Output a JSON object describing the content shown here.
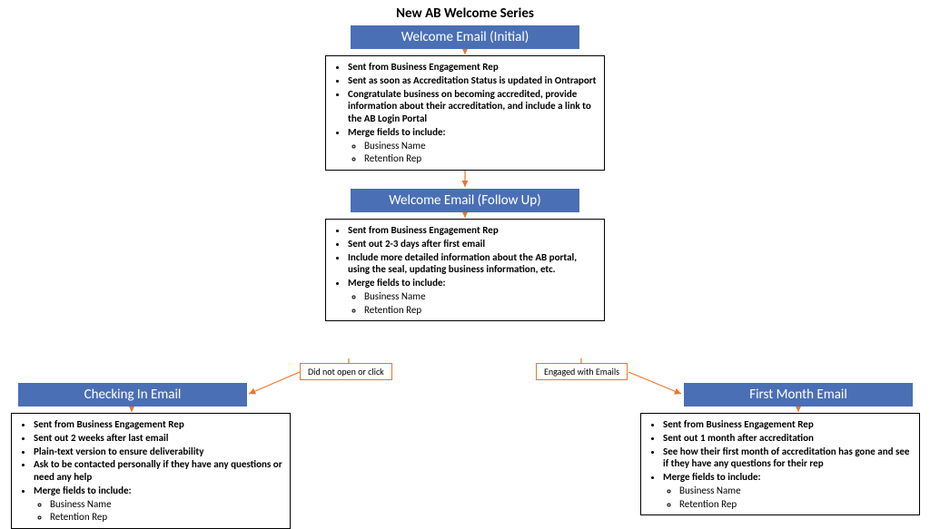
{
  "title": "New AB Welcome Series",
  "nodes": {
    "initial": {
      "header": "Welcome Email (Initial)",
      "b1": "Sent from Business Engagement Rep",
      "b2": "Sent as soon as Accreditation Status is updated in Ontraport",
      "b3": "Congratulate business on becoming accredited, provide information about their accreditation, and include a link to the AB Login Portal",
      "b4": "Merge fields to include:",
      "m1": "Business Name",
      "m2": "Retention Rep"
    },
    "followup": {
      "header": "Welcome Email (Follow Up)",
      "b1": "Sent from Business Engagement Rep",
      "b2": "Sent out 2-3 days after first email",
      "b3": "Include more detailed information about the AB portal, using the seal, updating business information, etc.",
      "b4": "Merge fields to include:",
      "m1": "Business Name",
      "m2": "Retention Rep"
    },
    "checkin": {
      "header": "Checking In Email",
      "b1": "Sent from Business Engagement Rep",
      "b2": "Sent out 2 weeks after last email",
      "b3": "Plain-text version to ensure deliverability",
      "b4": "Ask to be contacted personally if they have any questions or need any help",
      "b5": "Merge fields to include:",
      "m1": "Business Name",
      "m2": "Retention Rep"
    },
    "firstmonth": {
      "header": "First Month Email",
      "b1": "Sent from Business Engagement Rep",
      "b2": "Sent out 1 month after accreditation",
      "b3": "See how their first month of accreditation has gone and see if they have any questions for their rep",
      "b4": "Merge fields to include:",
      "m1": "Business Name",
      "m2": "Retention Rep"
    }
  },
  "branch_labels": {
    "left": "Did not open or click",
    "right": "Engaged with Emails"
  }
}
